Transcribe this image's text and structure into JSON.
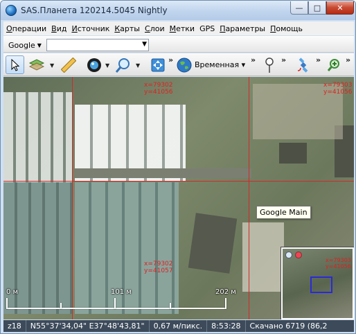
{
  "window": {
    "title": "SAS.Планета 120214.5045 Nightly",
    "minimize_glyph": "—",
    "maximize_glyph": "□",
    "close_glyph": "✕"
  },
  "menu": {
    "items": [
      {
        "label_ul": "О",
        "label_rest": "перации"
      },
      {
        "label_ul": "В",
        "label_rest": "ид"
      },
      {
        "label_ul": "И",
        "label_rest": "сточник"
      },
      {
        "label_ul": "К",
        "label_rest": "арты"
      },
      {
        "label_ul": "С",
        "label_rest": "лои"
      },
      {
        "label_ul": "М",
        "label_rest": "етки"
      },
      {
        "label_ul": "",
        "label_rest": "GPS"
      },
      {
        "label_ul": "П",
        "label_rest": "араметры"
      },
      {
        "label_ul": "П",
        "label_rest": "омощь"
      }
    ]
  },
  "toolbar1": {
    "source": "Google",
    "search_value": ""
  },
  "toolbar2": {
    "layer_label": "Временная",
    "icons": [
      "pointer-icon",
      "map-layers-icon",
      "ruler-icon",
      "globe-icon",
      "zoom-icon",
      "fullscreen-icon",
      "earth-icon",
      "placemark-icon",
      "gps-satellite-icon",
      "zoom-plus-icon"
    ]
  },
  "map": {
    "tile_labels": [
      {
        "x": "x=79302",
        "y": "y=41056"
      },
      {
        "x": "x=79303",
        "y": "y=41056"
      },
      {
        "x": "x=79302",
        "y": "y=41057"
      },
      {
        "x": "x=79303",
        "y": "y=41056"
      }
    ],
    "tooltip": "Google Main",
    "scale": {
      "left": "0 м",
      "mid": "101 м",
      "right": "202 м"
    }
  },
  "status": {
    "zoom": "z18",
    "coords": "N55°37'34,04\" E37°48'43,81\"",
    "resolution": "0,67 м/пикс.",
    "time": "8:53:28",
    "downloaded": "Скачано 6719 (86,2"
  },
  "colors": {
    "grid": "#d22a2a",
    "statusbar": "#3c4a5a",
    "selection_frame": "#2a2ad8"
  }
}
